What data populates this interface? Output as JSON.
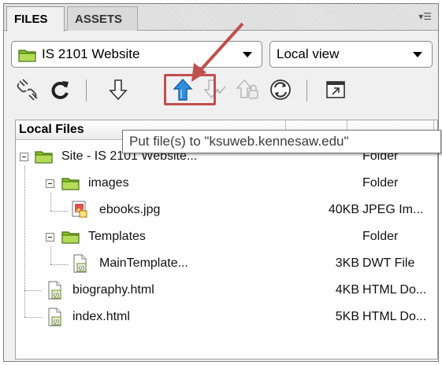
{
  "tabs": [
    {
      "label": "FILES",
      "active": true
    },
    {
      "label": "ASSETS",
      "active": false
    }
  ],
  "panel_menu_icon": "panel-options-icon",
  "site_select": {
    "value": "IS 2101 Website",
    "icon": "folder-icon"
  },
  "view_select": {
    "value": "Local view"
  },
  "toolbar": {
    "buttons": [
      "connect-icon",
      "refresh-icon",
      "get-file-icon",
      "put-file-icon",
      "check-out-icon",
      "check-in-icon",
      "synchronize-icon",
      "expand-icon"
    ],
    "highlighted": "put-file-icon",
    "highlight_color": "#c0504d"
  },
  "columns": {
    "local": "Local Files"
  },
  "tooltip": "Put file(s) to \"ksuweb.kennesaw.edu\"",
  "rows": [
    {
      "name": "Site - IS 2101 Website...",
      "size": "",
      "type": "Folder",
      "icon": "folder-icon",
      "level": 0
    },
    {
      "name": "images",
      "size": "",
      "type": "Folder",
      "icon": "folder-icon",
      "level": 1
    },
    {
      "name": "ebooks.jpg",
      "size": "40KB",
      "type": "JPEG Im...",
      "icon": "image-file-icon",
      "level": 2
    },
    {
      "name": "Templates",
      "size": "",
      "type": "Folder",
      "icon": "folder-icon",
      "level": 1
    },
    {
      "name": "MainTemplate...",
      "size": "3KB",
      "type": "DWT File",
      "icon": "template-file-icon",
      "level": 2
    },
    {
      "name": "biography.html",
      "size": "4KB",
      "type": "HTML Do...",
      "icon": "html-file-icon",
      "level": 1
    },
    {
      "name": "index.html",
      "size": "5KB",
      "type": "HTML Do...",
      "icon": "html-file-icon",
      "level": 1
    }
  ],
  "colors": {
    "folder": "#8cbf2a",
    "annotation": "#c0504d",
    "put_arrow": "#2f8fdc"
  }
}
